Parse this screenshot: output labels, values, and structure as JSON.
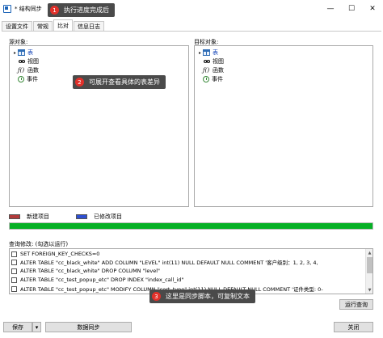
{
  "window": {
    "title": "* 结构同步",
    "controls": {
      "minimize": "—",
      "maximize": "☐",
      "close": "✕"
    }
  },
  "tabs": [
    "设置文件",
    "常规",
    "比对",
    "信息日志"
  ],
  "source": {
    "label": "源对象:",
    "items": [
      "表",
      "视图",
      "函数",
      "事件"
    ]
  },
  "target": {
    "label": "目标对象:",
    "items": [
      "表",
      "视图",
      "函数",
      "事件"
    ]
  },
  "legend": {
    "new_label": "新建项目",
    "modified_label": "已修改项目",
    "new_color": "#b03a3a",
    "modified_color": "#2e4fd0"
  },
  "progress": {
    "percent": 100,
    "color": "#06b025"
  },
  "query": {
    "label": "查询修改: (勾选以运行)",
    "rows": [
      "SET FOREIGN_KEY_CHECKS=0",
      "ALTER TABLE \"cc_black_white\" ADD COLUMN \"LEVEL\" int(11) NULL DEFAULT NULL COMMENT '客户级别：1, 2, 3, 4,",
      "ALTER TABLE \"cc_black_white\" DROP COLUMN \"level\"",
      "ALTER TABLE \"cc_test_popup_etc\" DROP INDEX \"index_call_id\"",
      "ALTER TABLE \"cc_test_popup_etc\" MODIFY COLUMN \"cert_type\" int(11) NULL DEFAULT NULL COMMENT '证件类型: 0-"
    ],
    "run_button": "运行查询"
  },
  "footer": {
    "save_button": "保存",
    "save_dropdown": "▾",
    "sync_button": "数据同步",
    "close_button": "关闭"
  },
  "callouts": [
    {
      "num": "1",
      "text": "执行进度完成后"
    },
    {
      "num": "2",
      "text": "可展开查看具体的表差异"
    },
    {
      "num": "3",
      "text": "这里是同步脚本，可复制文本"
    }
  ],
  "icons": {
    "expander": "▸",
    "glasses": "oo",
    "function": "ƒ()",
    "scroll_up": "▲",
    "scroll_down": "▼",
    "scroll_left": "◀",
    "scroll_right": "▶"
  }
}
